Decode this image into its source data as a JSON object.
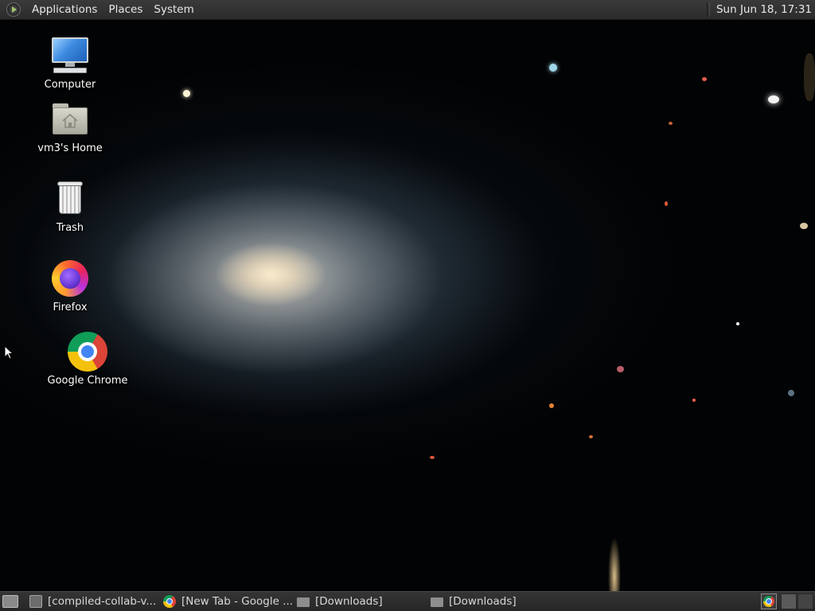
{
  "top_panel": {
    "menus": [
      "Applications",
      "Places",
      "System"
    ],
    "clock": "Sun Jun 18, 17:31"
  },
  "desktop": {
    "icons": [
      {
        "label": "Computer",
        "icon": "computer-icon"
      },
      {
        "label": "vm3's Home",
        "icon": "home-folder-icon"
      },
      {
        "label": "Trash",
        "icon": "trash-icon"
      },
      {
        "label": "Firefox",
        "icon": "firefox-icon"
      },
      {
        "label": "Google Chrome",
        "icon": "chrome-icon"
      }
    ]
  },
  "taskbar": {
    "tasks": [
      {
        "label": "[compiled-collab-v...",
        "icon": "terminal-icon"
      },
      {
        "label": "[New Tab - Google ...",
        "icon": "chrome-icon"
      },
      {
        "label": "[Downloads]",
        "icon": "folder-icon"
      },
      {
        "label": "[Downloads]",
        "icon": "folder-icon"
      }
    ]
  },
  "colors": {
    "panel": "#2b2b2b",
    "panel_text": "#e8e8e8",
    "desktop_bg": "#020304"
  }
}
